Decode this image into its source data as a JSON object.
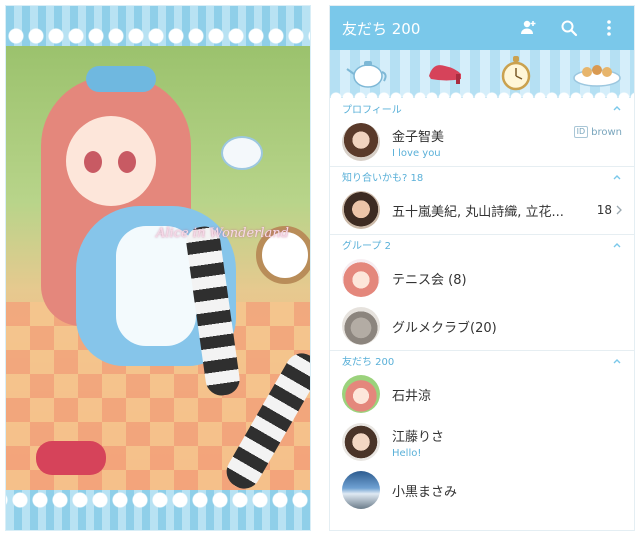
{
  "preview": {
    "script_text": "Alice in Wonderland"
  },
  "appbar": {
    "title": "友だち 200",
    "icons": [
      "add-friend-icon",
      "search-icon",
      "more-vertical-icon"
    ],
    "bg_color": "#7ac8ea"
  },
  "sections": {
    "profile": {
      "label": "プロフィール",
      "name": "金子智美",
      "status": "I love you",
      "id_badge": "ID",
      "id": "brown"
    },
    "suggestions": {
      "label": "知り合いかも? 18",
      "names": "五十嵐美紀, 丸山詩織, 立花...",
      "count": "18"
    },
    "groups": {
      "label": "グループ 2",
      "items": [
        {
          "name": "テニス会 (8)"
        },
        {
          "name": "グルメクラブ(20)"
        }
      ]
    },
    "friends": {
      "label": "友だち 200",
      "items": [
        {
          "name": "石井涼",
          "status": ""
        },
        {
          "name": "江藤りさ",
          "status": "Hello!"
        },
        {
          "name": "小黒まさみ",
          "status": ""
        }
      ]
    }
  },
  "accent_color": "#5ab0d8"
}
